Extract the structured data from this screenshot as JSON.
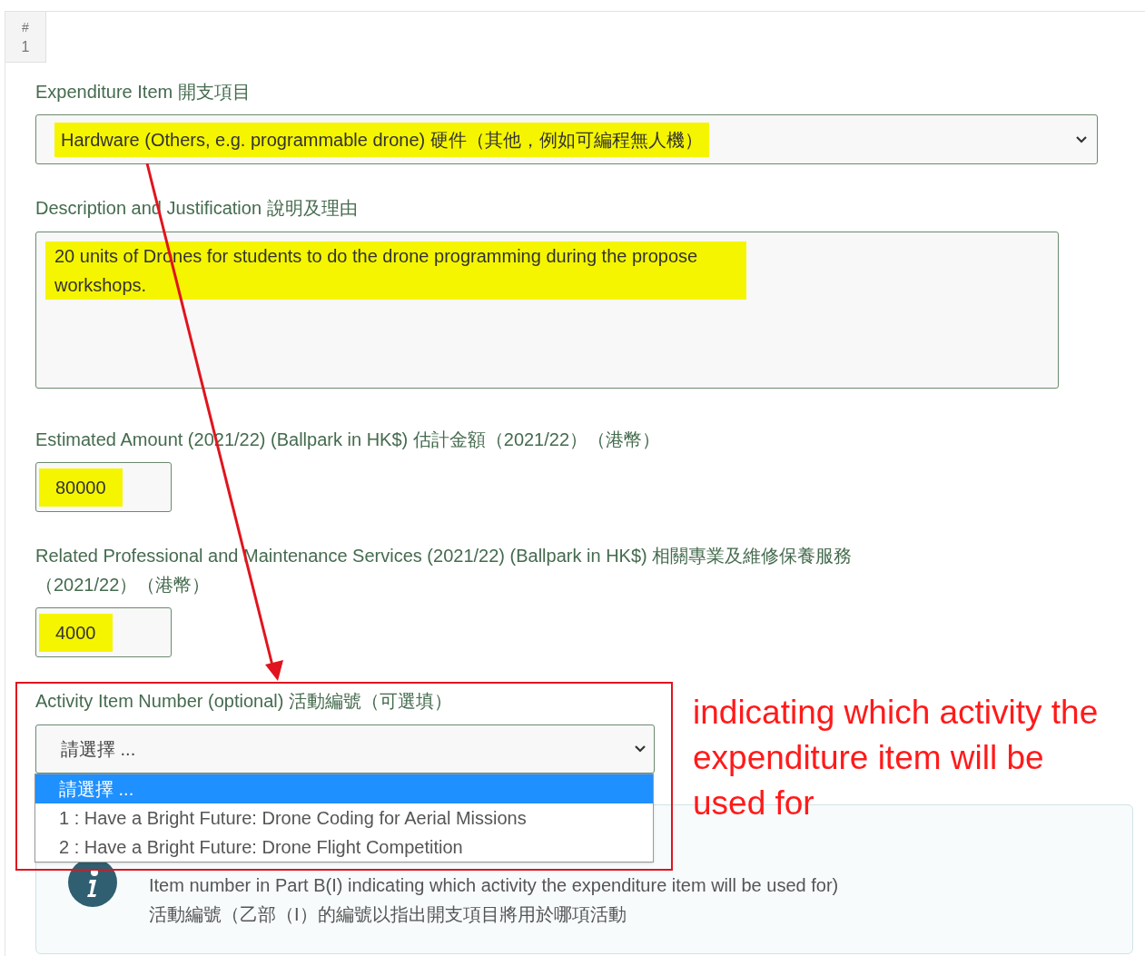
{
  "row_badge": {
    "symbol": "#",
    "number": "1"
  },
  "expenditure_item": {
    "label": "Expenditure Item 開支項目",
    "value": "Hardware (Others, e.g. programmable drone) 硬件（其他，例如可編程無人機）",
    "highlighted": true
  },
  "description": {
    "label": "Description and Justification 說明及理由",
    "value": "20 units of Drones for students to do the drone programming during the propose workshops.",
    "highlighted": true
  },
  "estimated_amount": {
    "label": "Estimated Amount (2021/22) (Ballpark in HK$) 估計金額（2021/22）（港幣）",
    "value": "80000",
    "highlighted": true
  },
  "related_services": {
    "label": "Related Professional and Maintenance Services (2021/22) (Ballpark in HK$) 相關專業及維修保養服務（2021/22）（港幣）",
    "value": "4000",
    "highlighted": true
  },
  "activity_item": {
    "label": "Activity Item Number (optional) 活動編號（可選填）",
    "value": "請選擇 ...",
    "expanded": true,
    "options": [
      {
        "label": "請選擇 ...",
        "selected": true
      },
      {
        "label": "1 : Have a Bright Future: Drone Coding for Aerial Missions",
        "selected": false
      },
      {
        "label": "2 : Have a Bright Future: Drone Flight Competition",
        "selected": false
      }
    ]
  },
  "info_box": {
    "lines": [
      "Item number in Part B(I) indicating which activity the expenditure item will be used for)",
      "活動編號（乙部（I）的編號以指出開支項目將用於哪項活動"
    ]
  },
  "annotation": {
    "text": "indicating which activity the expenditure item will be used for"
  }
}
